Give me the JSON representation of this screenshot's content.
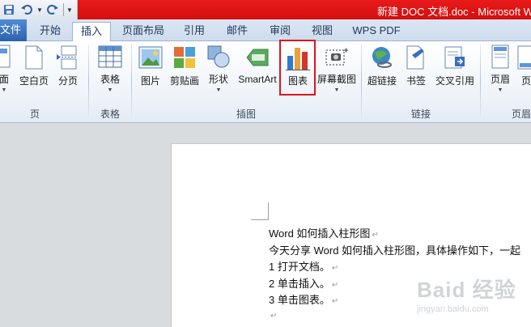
{
  "titlebar": {
    "title": "新建 DOC 文档.doc - Microsoft W"
  },
  "qat": {
    "save_icon": "save-icon",
    "undo_icon": "undo-icon",
    "redo_icon": "redo-icon",
    "dropdown_icon": "qat-dropdown-icon"
  },
  "tabs": [
    {
      "label": "文件"
    },
    {
      "label": "开始"
    },
    {
      "label": "插入"
    },
    {
      "label": "页面布局"
    },
    {
      "label": "引用"
    },
    {
      "label": "邮件"
    },
    {
      "label": "审阅"
    },
    {
      "label": "视图"
    },
    {
      "label": "WPS PDF"
    }
  ],
  "ribbon": {
    "buttons": [
      {
        "label": "面"
      },
      {
        "label": "空白页"
      },
      {
        "label": "分页"
      },
      {
        "label": "表格"
      },
      {
        "label": "图片"
      },
      {
        "label": "剪贴画"
      },
      {
        "label": "形状"
      },
      {
        "label": "SmartArt"
      },
      {
        "label": "图表"
      },
      {
        "label": "屏幕截图"
      },
      {
        "label": "超链接"
      },
      {
        "label": "书签"
      },
      {
        "label": "交叉引用"
      },
      {
        "label": "页眉"
      },
      {
        "label": "页"
      }
    ],
    "groups": [
      {
        "label": "页"
      },
      {
        "label": "表格"
      },
      {
        "label": "插图"
      },
      {
        "label": "链接"
      },
      {
        "label": "页眉"
      }
    ]
  },
  "document": {
    "lines": [
      {
        "text": "Word 如何插入柱形图"
      },
      {
        "text": "今天分享 Word 如何插入柱形图，具体操作如下，一起"
      },
      {
        "text": "1 打开文档。"
      },
      {
        "text": "2 单击插入。"
      },
      {
        "text": "3 单击图表。"
      },
      {
        "text": ""
      }
    ],
    "paragraph_mark": "↵"
  },
  "watermark": {
    "text": "Baid 经验",
    "sub": "jingyan.baidu.com"
  },
  "colors": {
    "titlebar": "#e01515",
    "highlight": "#e0141d",
    "tab_text": "#1e395b"
  }
}
